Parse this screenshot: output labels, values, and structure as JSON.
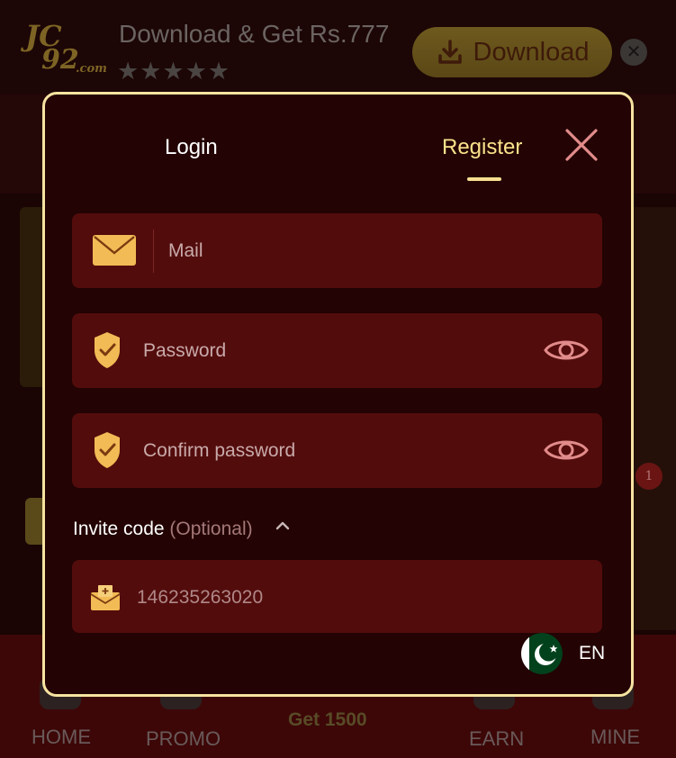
{
  "banner": {
    "logo_line1": "JC",
    "logo_line2": "92",
    "logo_line3": ".com",
    "text": "Download & Get Rs.777",
    "rating_stars": "★★★★★",
    "download_label": "Download",
    "close_glyph": "✕"
  },
  "background": {
    "notification_count": "1"
  },
  "bottom_nav": {
    "items": [
      "HOME",
      "PROMO",
      "Get 1500",
      "EARN",
      "MINE"
    ]
  },
  "modal": {
    "tabs": {
      "login": "Login",
      "register": "Register",
      "active": "register"
    },
    "fields": {
      "mail": {
        "placeholder": "Mail",
        "icon": "mail-icon"
      },
      "password": {
        "placeholder": "Password",
        "icon": "shield-check-icon",
        "toggle_icon": "eye-icon"
      },
      "confirm_password": {
        "placeholder": "Confirm password",
        "icon": "shield-check-icon",
        "toggle_icon": "eye-icon"
      }
    },
    "invite": {
      "label": "Invite code",
      "optional": "(Optional)",
      "value": "146235263020",
      "icon": "gift-mail-icon",
      "expanded": true
    },
    "language": {
      "code": "EN",
      "flag": "pakistan-flag-icon"
    }
  },
  "colors": {
    "modal_bg": "#230303",
    "modal_border": "#f6e3a1",
    "field_bg": "#530c0c",
    "accent_gold": "#fbe38c",
    "icon_gold": "#f2bb55",
    "close_pink": "#e28b8b"
  }
}
